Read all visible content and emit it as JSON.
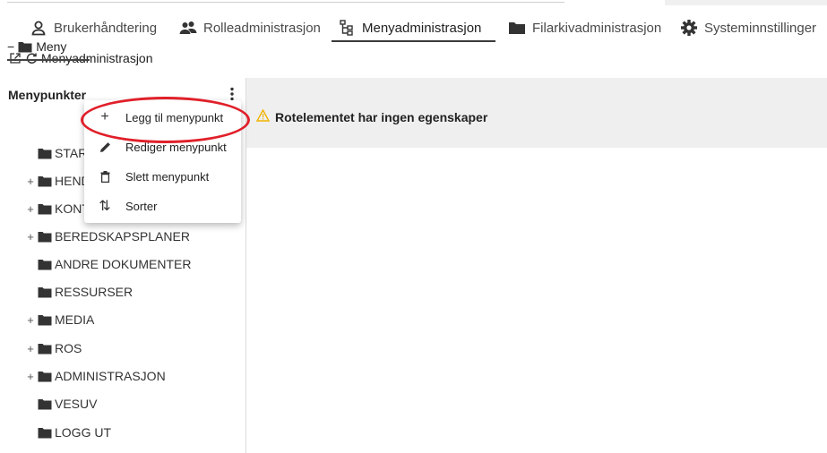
{
  "tabs": [
    {
      "label": "Brukerhåndtering",
      "icon": "user-icon"
    },
    {
      "label": "Rolleadministrasjon",
      "icon": "users-icon"
    },
    {
      "label": "Menyadministrasjon",
      "icon": "tree-icon",
      "active": true
    },
    {
      "label": "Filarkivadministrasjon",
      "icon": "folder-icon"
    },
    {
      "label": "Systeminnstillinger",
      "icon": "gear-icon"
    }
  ],
  "page_header": {
    "title": "Menyadministrasjon"
  },
  "left_panel": {
    "title": "Menypunkter",
    "root": {
      "label": "Meny",
      "expand": "−"
    },
    "items": [
      {
        "label": "STARTSIDE",
        "expand": ""
      },
      {
        "label": "HENDELSER",
        "expand": "+"
      },
      {
        "label": "KONTAKTER",
        "expand": "+"
      },
      {
        "label": "BEREDSKAPSPLANER",
        "expand": "+"
      },
      {
        "label": "ANDRE DOKUMENTER",
        "expand": ""
      },
      {
        "label": "RESSURSER",
        "expand": ""
      },
      {
        "label": "MEDIA",
        "expand": "+"
      },
      {
        "label": "ROS",
        "expand": "+"
      },
      {
        "label": "ADMINISTRASJON",
        "expand": "+"
      },
      {
        "label": "VESUV",
        "expand": ""
      },
      {
        "label": "LOGG UT",
        "expand": ""
      }
    ]
  },
  "context_menu": {
    "items": [
      {
        "label": "Legg til menypunkt",
        "icon": "plus-icon",
        "glyph": "+"
      },
      {
        "label": "Rediger menypunkt",
        "icon": "pencil-icon",
        "glyph": ""
      },
      {
        "label": "Slett menypunkt",
        "icon": "trash-icon",
        "glyph": ""
      },
      {
        "label": "Sorter",
        "icon": "sort-icon",
        "glyph": "⇅"
      }
    ]
  },
  "right_panel": {
    "message": "Rotelementet har ingen egenskaper"
  },
  "colors": {
    "highlight": "#e0202a",
    "warning": "#f0b400",
    "panel_bg": "#efefef"
  }
}
